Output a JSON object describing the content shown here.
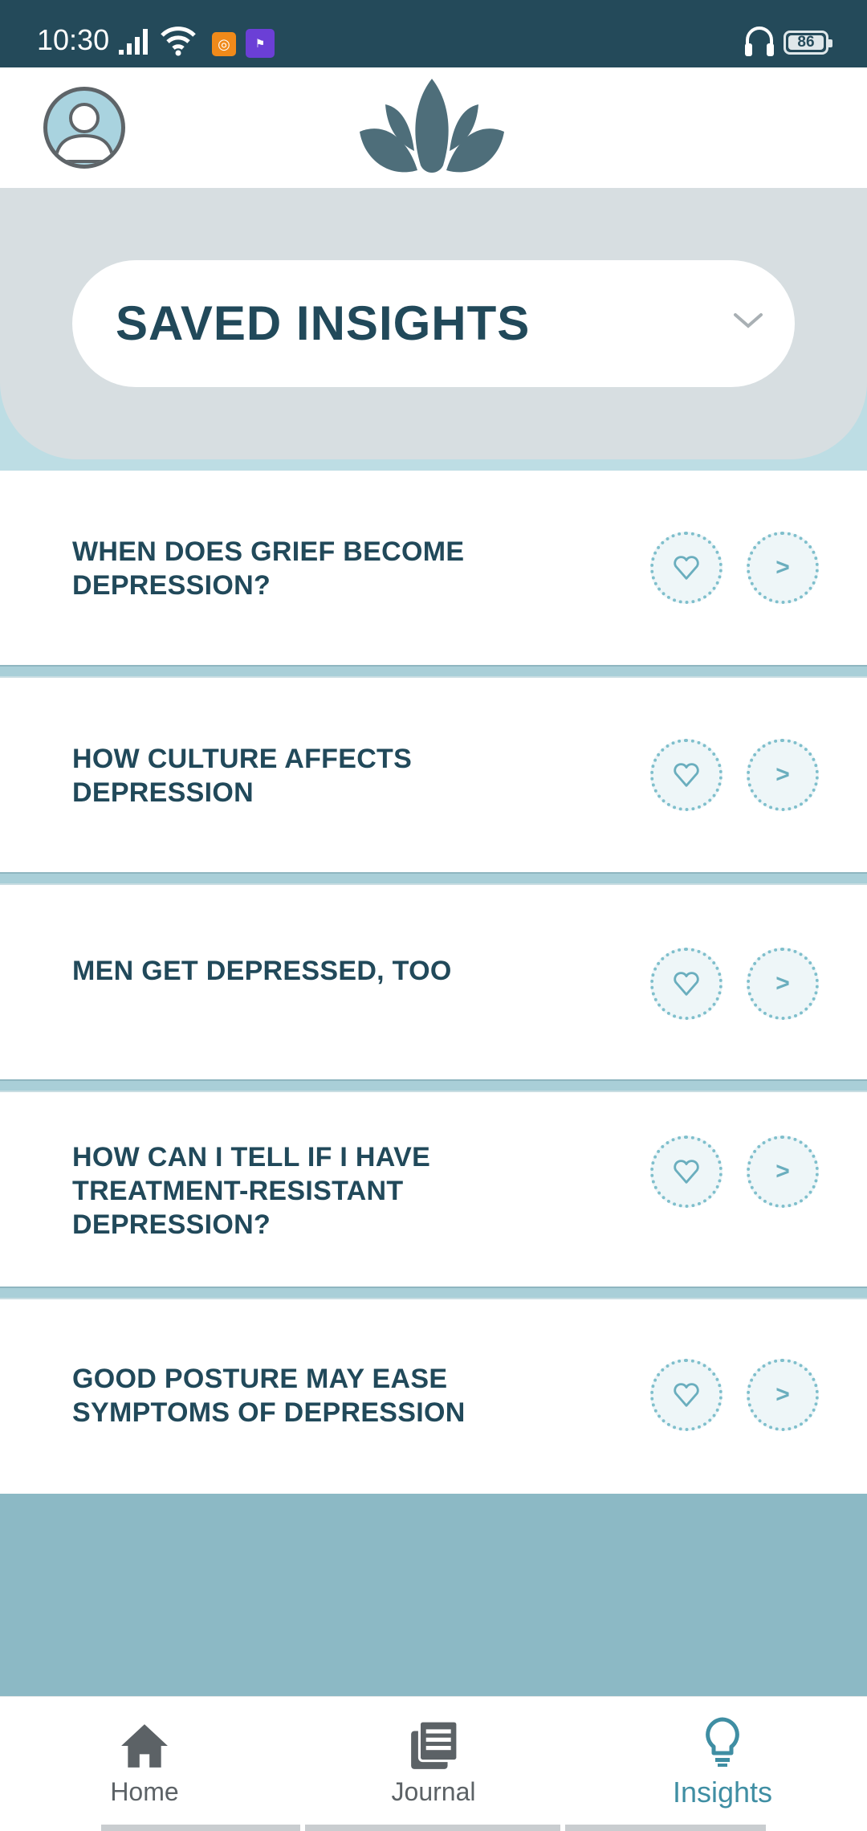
{
  "status_bar": {
    "time": "10:30",
    "battery": "86",
    "icons": [
      "signal-icon",
      "wifi-icon",
      "app-notification-icon",
      "app-notification-icon",
      "headset-icon",
      "battery-icon"
    ]
  },
  "header": {
    "avatar_icon": "user-avatar-icon",
    "logo_icon": "lotus-logo-icon"
  },
  "section": {
    "dropdown_label": "SAVED INSIGHTS"
  },
  "insights": [
    {
      "title": "WHEN DOES GRIEF BECOME DEPRESSION?",
      "lines": [
        "WHEN DOES GRIEF BECOME",
        "DEPRESSION?"
      ],
      "fav_glyph": "♡",
      "open_glyph": ">"
    },
    {
      "title": "HOW CULTURE AFFECTS DEPRESSION",
      "lines": [
        "HOW CULTURE AFFECTS",
        "DEPRESSION"
      ],
      "fav_glyph": "♡",
      "open_glyph": ">"
    },
    {
      "title": "MEN GET DEPRESSED, TOO",
      "lines": [
        "MEN GET DEPRESSED, TOO"
      ],
      "fav_glyph": "♡",
      "open_glyph": ">"
    },
    {
      "title": "HOW CAN I TELL IF I HAVE TREATMENT-RESISTANT DEPRESSION?",
      "lines": [
        "HOW CAN I TELL IF I HAVE",
        "TREATMENT-RESISTANT",
        "DEPRESSION?"
      ],
      "fav_glyph": "♡",
      "open_glyph": ">"
    },
    {
      "title": "GOOD POSTURE MAY EASE SYMPTOMS OF DEPRESSION",
      "lines": [
        "GOOD POSTURE MAY EASE",
        "SYMPTOMS OF DEPRESSION"
      ],
      "fav_glyph": "♡",
      "open_glyph": ">"
    }
  ],
  "bottom_nav": {
    "items": [
      {
        "label": "Home",
        "icon": "home-icon",
        "active": false
      },
      {
        "label": "Journal",
        "icon": "journal-icon",
        "active": false
      },
      {
        "label": "Insights",
        "icon": "lightbulb-icon",
        "active": true
      }
    ]
  },
  "colors": {
    "status_bar": "#244a5a",
    "primary_text": "#21495a",
    "accent": "#3f8ea3",
    "panel": "#d7dee1",
    "footer": "#8cb9c5"
  }
}
